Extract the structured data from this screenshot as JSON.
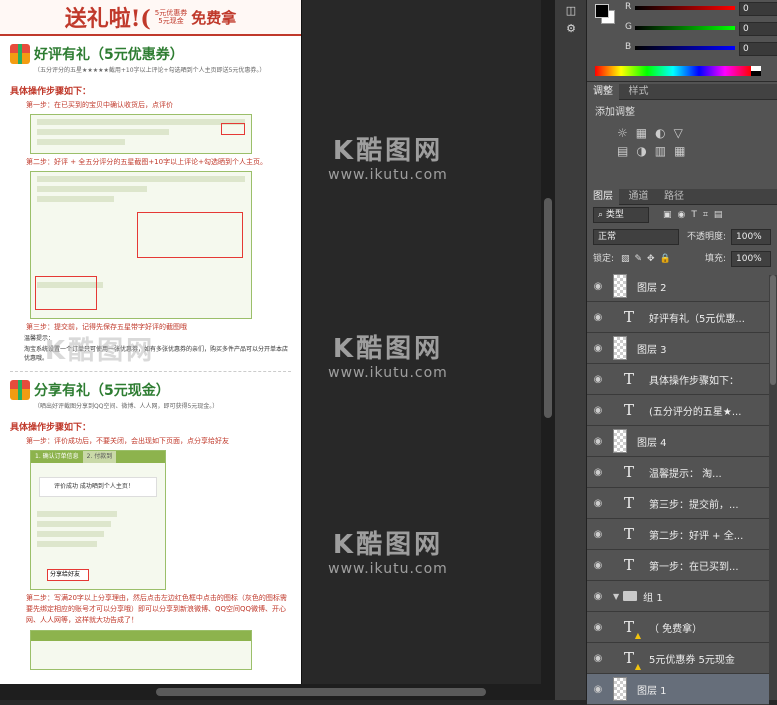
{
  "document": {
    "banner": {
      "main": "送礼啦!(",
      "mini_top": "5元优惠券",
      "mini_bottom": "5元现金",
      "free": "免费拿"
    },
    "section1": {
      "title": "好评有礼（5元优惠券）",
      "subtitle": "（五分评分的五星★★★★★截用+10字以上评论+勾选晒到个人主页即送5元优惠券。）",
      "steps_title": "具体操作步骤如下：",
      "step1": "第一步：在已买到的宝贝中确认收货后，点评价",
      "step2": "第二步：好评 + 全五分评分的五星截图+10字以上评论+勾选晒到个人主页。",
      "step3": "第三步：提交前，记得先保存五星带字好评的截图哦",
      "tip_title": "温馨提示：",
      "tip_body": "淘宝系统设置一个订单只可使用一张优惠券，如有多张优惠券的亲们，购买多件产品可以分开单本店优惠哦。"
    },
    "section2": {
      "title": "分享有礼（5元现金）",
      "subtitle": "（晒出好评截图分享到QQ空间、微博、人人网，即可获得5元现金。）",
      "steps_title": "具体操作步骤如下：",
      "step1": "第一步：评价成功后，不要关闭，会出现如下页面，点分享给好友",
      "step2": "第二步：写满20字以上分享理由，然后点击左边红色框中点击的图标（灰色的图标需要先绑定相应的账号才可以分享哦）即可以分享到新浪微博、QQ空间QQ微博、开心网、人人网等，这样就大功告成了！",
      "dialog_title": "评价成功 成功晒到个人主页！",
      "share_btn": "分享给好友",
      "tab1": "1. 确认订单信息",
      "tab2": "2. 付款到"
    }
  },
  "watermark": {
    "logo": "K酷图网",
    "url": "www.ikutu.com"
  },
  "color_panel": {
    "channels": [
      {
        "label": "R",
        "value": "0"
      },
      {
        "label": "G",
        "value": "0"
      },
      {
        "label": "B",
        "value": "0"
      }
    ]
  },
  "adjust_tabs": [
    "调整",
    "样式"
  ],
  "adjust_title": "添加调整",
  "layers_tabs": [
    "图层",
    "通道",
    "路径"
  ],
  "layers_filter": "类型",
  "blend_mode": "正常",
  "opacity_label": "不透明度:",
  "opacity_value": "100%",
  "lock_label": "锁定:",
  "fill_label": "填充:",
  "fill_value": "100%",
  "layers": [
    {
      "kind": "image",
      "name": "图层 2"
    },
    {
      "kind": "text",
      "name": "好评有礼（5元优惠..."
    },
    {
      "kind": "image",
      "name": "图层 3"
    },
    {
      "kind": "text",
      "name": "具体操作步骤如下："
    },
    {
      "kind": "text",
      "name": "(五分评分的五星★..."
    },
    {
      "kind": "image",
      "name": "图层 4"
    },
    {
      "kind": "text",
      "name": "温馨提示：  淘..."
    },
    {
      "kind": "text",
      "name": "第三步：提交前，..."
    },
    {
      "kind": "text",
      "name": "第二步：好评 + 全..."
    },
    {
      "kind": "text",
      "name": "第一步：在已买到..."
    },
    {
      "kind": "group",
      "name": "组 1"
    },
    {
      "kind": "text-warn",
      "name": "（       免费拿）"
    },
    {
      "kind": "text-warn",
      "name": "5元优惠券 5元现金"
    },
    {
      "kind": "image",
      "name": "图层 1",
      "selected": true
    }
  ]
}
